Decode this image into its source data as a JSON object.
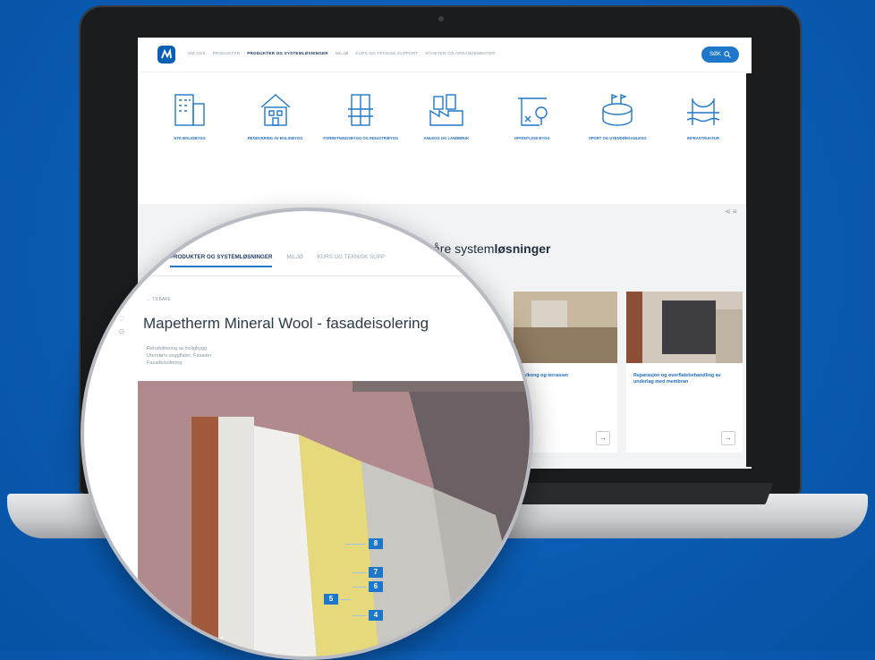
{
  "nav": {
    "links": [
      "OM OSS",
      "PRODUKTER",
      "PRODUKTER OG SYSTEMLØSNINGER",
      "MILJØ",
      "KURS OG TEKNISK SUPPORT",
      "NYHETER OG ARRANGEMENTER"
    ],
    "active_index": 2,
    "search_label": "SØK"
  },
  "categories": [
    {
      "label": "NYE BOLIGBYGG",
      "icon": "apartment-building-icon"
    },
    {
      "label": "RENOVERING AV BOLIGBYGG",
      "icon": "house-icon"
    },
    {
      "label": "FORRETNINGSBYGG OG INDUSTRIBYGG",
      "icon": "office-building-icon"
    },
    {
      "label": "ANLEGG OG LANDBRUK",
      "icon": "factory-icon"
    },
    {
      "label": "OFFENTLIGE BYGG",
      "icon": "public-building-icon"
    },
    {
      "label": "SPORT OG UTENDØRSANLEGG",
      "icon": "stadium-icon"
    },
    {
      "label": "INFRASTRUKTUR",
      "icon": "bridge-icon"
    }
  ],
  "section": {
    "title_prefix": "åre system",
    "title_bold": "løsninger"
  },
  "cards": [
    {
      "text": "balkong og terrasser"
    },
    {
      "text": "Reparasjon og overflatebehandling av underlag med membran"
    }
  ],
  "magnifier": {
    "tabs": [
      "EW",
      "PRODUKTER OG SYSTEMLØSNINGER",
      "MILJØ",
      "KURS OG TEKNISK SUPP"
    ],
    "active_tab_index": 1,
    "back_link": "← TILBAKE",
    "product_title": "Mapetherm Mineral Wool - fasadeisolering",
    "meta_lines": [
      "Rehabilitering av boligbygg",
      "Utendørs veggflater, Fasader",
      "Fasadeisolering"
    ],
    "badges": [
      "8",
      "7",
      "6",
      "5",
      "4"
    ]
  },
  "colors": {
    "background": "#0a5cb4",
    "accent": "#1f77c9",
    "link": "#1f6fc0"
  }
}
